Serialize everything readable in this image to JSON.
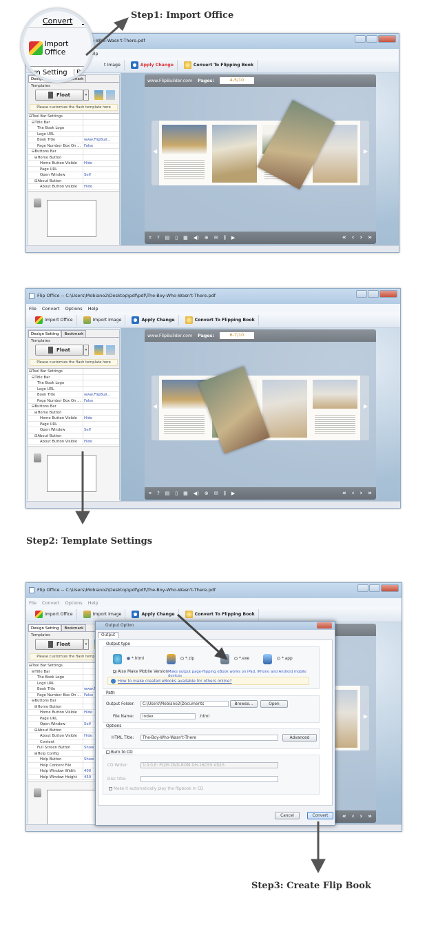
{
  "steps": {
    "step1": "Step1: Import Office",
    "step2": "Step2: Template Settings",
    "step3": "Step3: Create Flip Book"
  },
  "magnifier": {
    "menu_convert": "Convert",
    "menu_partial": "O",
    "import_office": "Import Office",
    "tab_partial": "sign Setting",
    "tab2_partial": "Bo"
  },
  "app": {
    "title": "Flip Office  -- C:\\Users\\Mobiano2\\Desktop\\pdf\\pdf\\The-Boy-Who-Wasn't-There.pdf",
    "title_partial": "\\Desktop\\pdf\\pdf\\The-Boy-Who-Wasn't-There.pdf",
    "menu": [
      "File",
      "Convert",
      "Options",
      "Help"
    ],
    "toolbar": {
      "import_office": "Import Office",
      "import_image": "Import Image",
      "import_image_partial": "t Image",
      "apply_change": "Apply Change",
      "convert": "Convert To Flipping Book"
    },
    "tabs": [
      "Design Setting",
      "Bookmark"
    ],
    "templates_label": "Templates",
    "template_name": "Float",
    "customize_note": "Please customize the flash template here",
    "properties": [
      {
        "k": "⊟Tool Bar Settings",
        "v": "",
        "i": 0
      },
      {
        "k": "⊟Title Bar",
        "v": "",
        "i": 1
      },
      {
        "k": "The Book Logo",
        "v": "",
        "i": 3
      },
      {
        "k": "Logo URL",
        "v": "",
        "i": 3
      },
      {
        "k": "Book Title",
        "v": "www.FlipBuil...",
        "i": 3
      },
      {
        "k": "Page Number Box On ...",
        "v": "False",
        "i": 3
      },
      {
        "k": "⊟Buttons Bar",
        "v": "",
        "i": 1
      },
      {
        "k": "⊟Home Button",
        "v": "",
        "i": 2
      },
      {
        "k": "Home Button Visible",
        "v": "Hide",
        "i": 4
      },
      {
        "k": "Page URL",
        "v": "",
        "i": 4
      },
      {
        "k": "Open Window",
        "v": "Self",
        "i": 4
      },
      {
        "k": "⊟About Button",
        "v": "",
        "i": 2
      },
      {
        "k": "About Button Visible",
        "v": "Hide",
        "i": 4
      },
      {
        "k": "Content",
        "v": "",
        "i": 4
      },
      {
        "k": "Full Screen Button",
        "v": "Show",
        "i": 3
      },
      {
        "k": "⊟Help Config",
        "v": "",
        "i": 2
      },
      {
        "k": "Help Button",
        "v": "Show",
        "i": 4
      },
      {
        "k": "Help Content File",
        "v": "",
        "i": 4
      },
      {
        "k": "Help Window Width",
        "v": "400",
        "i": 4
      },
      {
        "k": "Help Window Height",
        "v": "450",
        "i": 4
      }
    ],
    "viewer": {
      "site": "www.FlipBuilder.com",
      "pages_label": "Pages:",
      "pages_step1": "4-5/10",
      "pages_step2": "6-7/10",
      "nav_icons": [
        "fullscreen-icon",
        "help-icon",
        "print-icon",
        "page-icon",
        "thumbnails-icon",
        "sound-icon",
        "zoom-icon",
        "email-icon",
        "share-icon",
        "autoplay-icon"
      ],
      "nav_glyphs": [
        "⌗",
        "?",
        "▤",
        "▯",
        "▦",
        "◀)",
        "⊕",
        "✉",
        "⫼",
        "▶"
      ],
      "page_nav": [
        "«",
        "‹",
        "›",
        "»"
      ]
    }
  },
  "dialog": {
    "title": "Output Option",
    "tab": "Output",
    "output_type": "Output type",
    "types": [
      "*.html",
      "*.zip",
      "*.exe",
      "*.app"
    ],
    "mobile_check": "Also Make Mobile Version",
    "mobile_note": "Make output page-flipping eBook works on iPad, iPhone and Android mobile devices",
    "help_link": "How to make created eBooks available for others online?",
    "path": "Path",
    "output_folder_label": "Output Folder:",
    "output_folder": "C:\\Users\\Mobiano2\\Documents",
    "browse": "Browse...",
    "open": "Open",
    "file_name_label": "File Name:",
    "file_name": "index",
    "file_ext": ".html",
    "options": "Options",
    "html_title_label": "HTML Title:",
    "html_title": "The-Boy-Who-Wasn't-There",
    "advanced": "Advanced",
    "burn_cd": "Burn to CD",
    "cd_writer_label": "CD Writer:",
    "cd_writer": "1:0:0,E: PLDS    DVD-ROM DH-16D5S VD15",
    "disc_title_label": "Disc title:",
    "autoplay": "Make it automatically play the flipbook in CD",
    "cancel": "Cancel",
    "convert": "Convert"
  }
}
